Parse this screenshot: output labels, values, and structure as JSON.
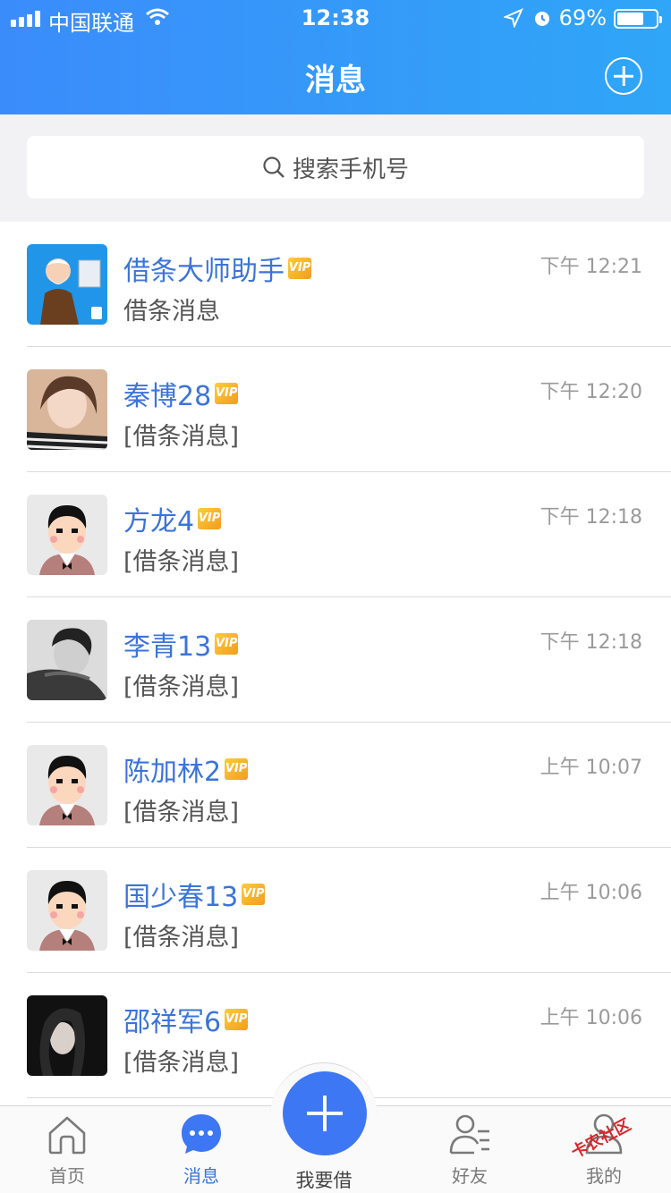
{
  "status": {
    "carrier": "中国联通",
    "time": "12:38",
    "battery": "69%",
    "battery_level": 0.69,
    "icons": [
      "signal-icon",
      "wifi-icon",
      "location-icon",
      "alarm-icon",
      "battery-icon"
    ]
  },
  "nav": {
    "title": "消息",
    "add_icon": "add-circle-icon"
  },
  "search": {
    "placeholder": "搜索手机号",
    "icon": "search-icon"
  },
  "messages": [
    {
      "name": "借条大师助手",
      "vip": "VIP",
      "time": "下午 12:21",
      "preview": "借条消息",
      "avatar": "assistant-avatar"
    },
    {
      "name": "秦博28",
      "vip": "VIP",
      "time": "下午 12:20",
      "preview": "[借条消息]",
      "avatar": "photo-avatar"
    },
    {
      "name": "方龙4",
      "vip": "VIP",
      "time": "下午 12:18",
      "preview": "[借条消息]",
      "avatar": "default-avatar"
    },
    {
      "name": "李青13",
      "vip": "VIP",
      "time": "下午 12:18",
      "preview": "[借条消息]",
      "avatar": "photo-avatar"
    },
    {
      "name": "陈加林2",
      "vip": "VIP",
      "time": "上午 10:07",
      "preview": "[借条消息]",
      "avatar": "default-avatar"
    },
    {
      "name": "国少春13",
      "vip": "VIP",
      "time": "上午 10:06",
      "preview": "[借条消息]",
      "avatar": "default-avatar"
    },
    {
      "name": "邵祥军6",
      "vip": "VIP",
      "time": "上午 10:06",
      "preview": "[借条消息]",
      "avatar": "photo-avatar"
    }
  ],
  "tabbar": {
    "tabs": [
      {
        "label": "首页",
        "icon": "home-icon"
      },
      {
        "label": "消息",
        "icon": "chat-icon",
        "active": true
      },
      {
        "label": "我要借",
        "icon": "plus-icon"
      },
      {
        "label": "好友",
        "icon": "friends-icon"
      },
      {
        "label": "我的",
        "icon": "profile-icon"
      }
    ]
  },
  "watermark": "卡农社区",
  "colors": {
    "header_start": "#3b8cfb",
    "header_end": "#2fa6f7",
    "name_blue": "#3b74d9",
    "fab_blue": "#3d77f4",
    "vip_gold": "#f29c1f"
  }
}
